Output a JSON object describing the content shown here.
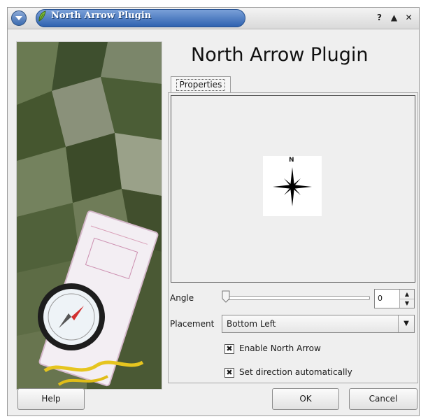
{
  "window": {
    "title": "North Arrow Plugin",
    "controls": {
      "help": "?",
      "maximize": "▲",
      "close": "✕"
    }
  },
  "header": {
    "title": "North Arrow Plugin"
  },
  "tabs": [
    {
      "label": "Properties",
      "active": true
    }
  ],
  "preview": {
    "north_label": "N"
  },
  "angle": {
    "label": "Angle",
    "value": "0",
    "slider_fraction": 0
  },
  "placement": {
    "label": "Placement",
    "selected": "Bottom Left"
  },
  "checkboxes": {
    "enable": {
      "label": "Enable North Arrow",
      "checked": true,
      "mark": "✖"
    },
    "auto": {
      "label": "Set direction automatically",
      "checked": true,
      "mark": "✖"
    }
  },
  "buttons": {
    "help": "Help",
    "ok": "OK",
    "cancel": "Cancel"
  },
  "colors": {
    "title_accent": "#3b6bb0",
    "panel_bg": "#efefef"
  }
}
